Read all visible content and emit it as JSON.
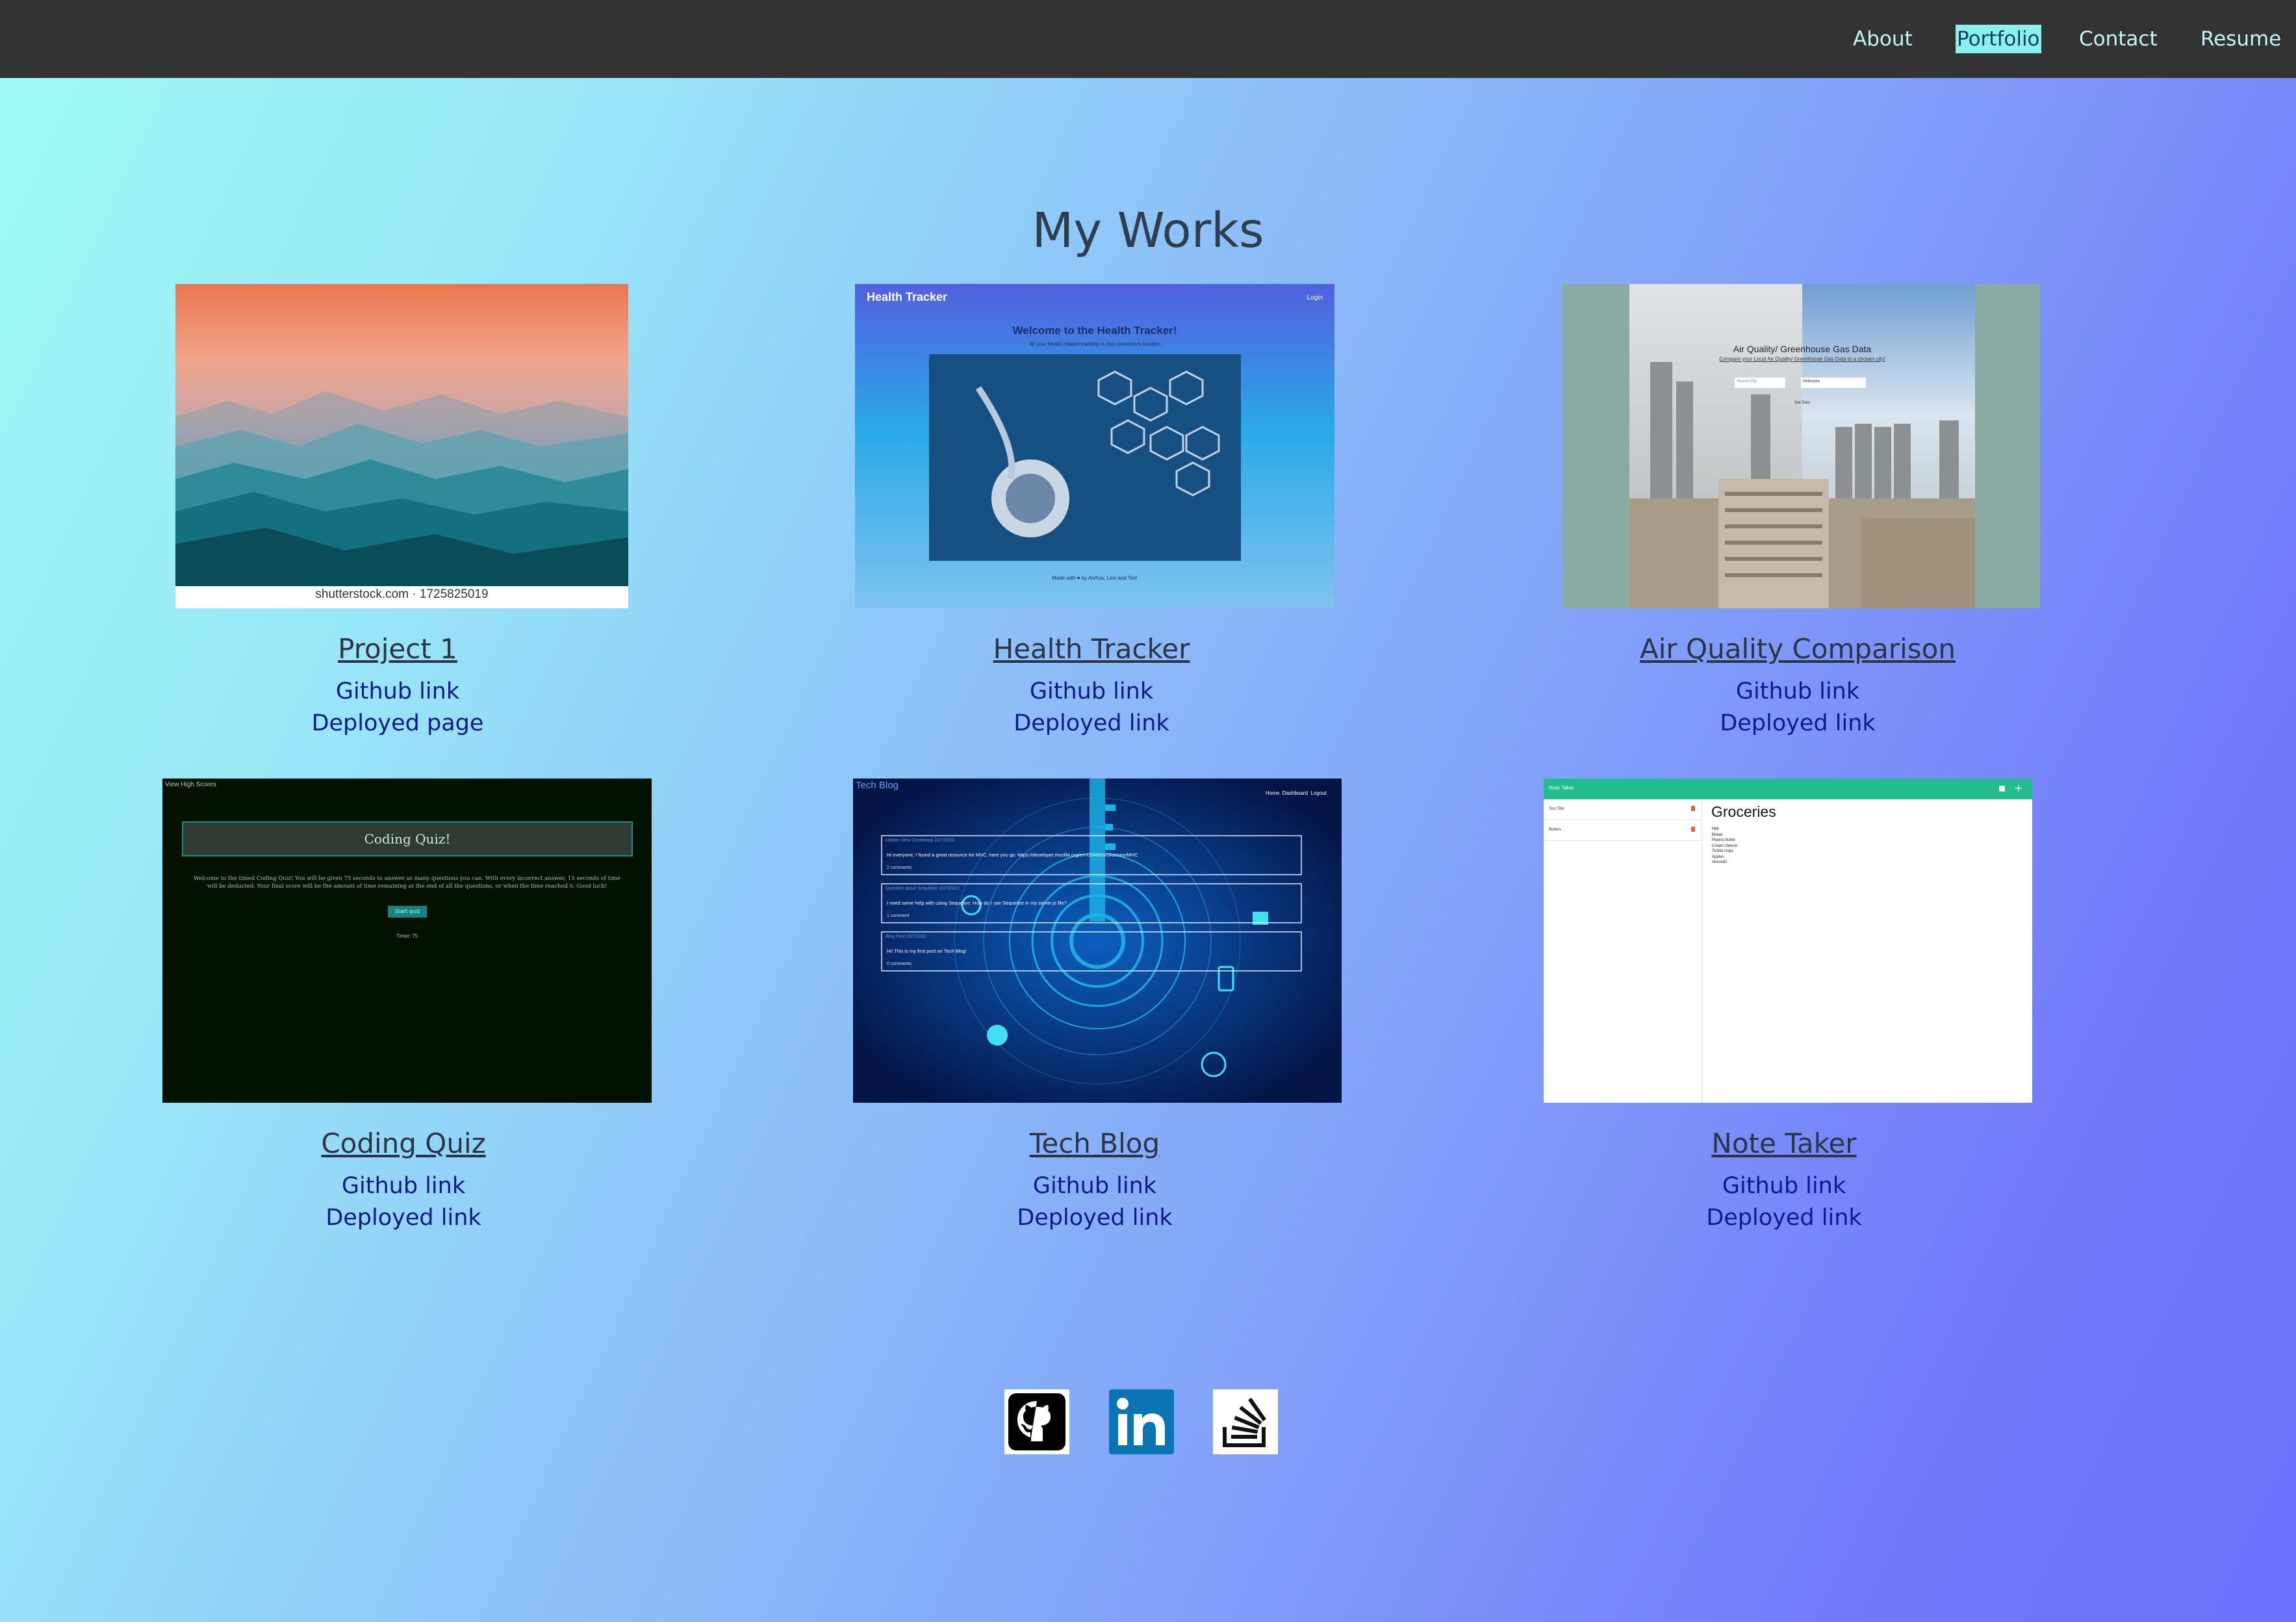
{
  "nav": {
    "items": [
      {
        "label": "About",
        "active": false
      },
      {
        "label": "Portfolio",
        "active": true
      },
      {
        "label": "Contact",
        "active": false
      },
      {
        "label": "Resume",
        "active": false
      }
    ]
  },
  "page_title": "My Works",
  "projects": [
    {
      "title": "Project 1",
      "link1": "Github link",
      "link2": "Deployed page",
      "thumb": {
        "caption": "shutterstock.com · 1725825019"
      }
    },
    {
      "title": "Health Tracker",
      "link1": "Github link",
      "link2": "Deployed link",
      "thumb": {
        "brand": "Health Tracker",
        "login": "Login",
        "heading": "Welcome to the Health Tracker!",
        "sub": "All your health related tracking in one convenient location",
        "footer": "Made with ♥ by Aivhus, Lexi and Tori!"
      }
    },
    {
      "title": "Air Quality Comparison",
      "link1": "Github link",
      "link2": "Deployed link",
      "thumb": {
        "heading": "Air Quality/ Greenhouse Gas Data",
        "sub": "Compare your Local Air Quality/ Greenhouse Gas Data to a chosen city!",
        "input1": "Search City",
        "input2": "Nebraska",
        "button": "Get Data"
      }
    },
    {
      "title": "Coding Quiz",
      "link1": "Github link",
      "link2": "Deployed link",
      "thumb": {
        "highscores": "View High Scores",
        "heading": "Coding Quiz!",
        "text1": "Welcome to the timed Coding Quiz! You will be given 75 seconds to answer as many questions you can. With every incorrect answer, 15 seconds of time",
        "text2": "will be deducted. Your final score will be the amount of time remaining at the end of all the questions, or when the time reached 0. Good luck!",
        "button": "Start quiz",
        "timer": "Timer: 75"
      }
    },
    {
      "title": "Tech Blog",
      "link1": "Github link",
      "link2": "Deployed link",
      "thumb": {
        "brand": "Tech Blog",
        "nav": [
          "Home",
          "Dashboard",
          "Logout"
        ],
        "posts": [
          {
            "head": "Hidden New Centennial 10/7/2022",
            "body": "Hi everyone, I found a great resource for MVC, here you go: https://developer.mozilla.org/en-US/docs/Glossary/MVC",
            "meta": "2 comments"
          },
          {
            "head": "Question about Sequelize 10/7/2022",
            "body": "I need some help with using Sequelize. How do I use Sequelize in my server.js file?",
            "meta": "1 comment"
          },
          {
            "head": "Blog Post 10/7/2022",
            "body": "Hi! This is my first post on Tech Blog!",
            "meta": "0 comments"
          }
        ]
      }
    },
    {
      "title": "Note Taker",
      "link1": "Github link",
      "link2": "Deployed link",
      "thumb": {
        "brand": "Note Taker",
        "notes": [
          "Test Title",
          "Butters"
        ],
        "heading": "Groceries",
        "items": [
          "Milk",
          "Bread",
          "Peanut butter",
          "Cream cheese",
          "Tortilla chips",
          "Apples",
          "Almonds"
        ]
      }
    }
  ],
  "social": [
    {
      "name": "github"
    },
    {
      "name": "linkedin"
    },
    {
      "name": "stackoverflow"
    }
  ],
  "colors": {
    "nav_bg": "#333333",
    "nav_text": "#bff7f4",
    "nav_active_bg": "#88f3ee",
    "title_text": "#2f3e4e",
    "link_text": "#0d1a8f"
  }
}
